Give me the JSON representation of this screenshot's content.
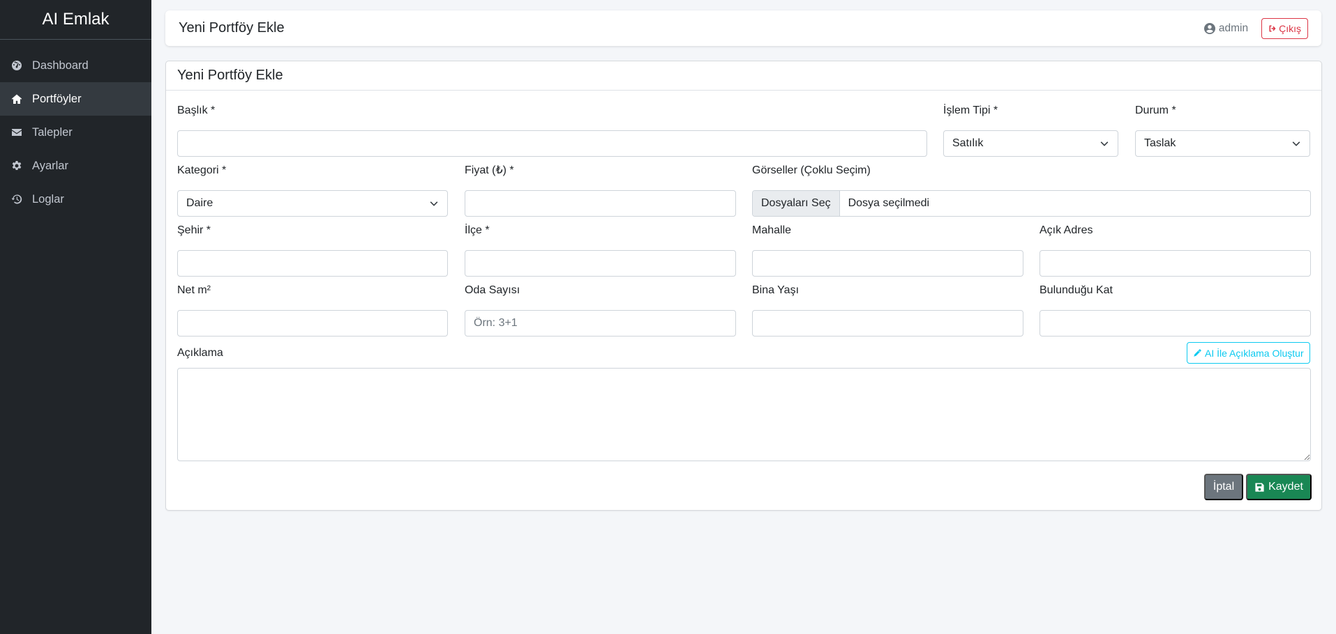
{
  "sidebar": {
    "brand": "AI Emlak",
    "items": [
      {
        "label": "Dashboard",
        "icon": "tachometer-icon",
        "active": false
      },
      {
        "label": "Portföyler",
        "icon": "home-icon",
        "active": true
      },
      {
        "label": "Talepler",
        "icon": "envelope-icon",
        "active": false
      },
      {
        "label": "Ayarlar",
        "icon": "gear-icon",
        "active": false
      },
      {
        "label": "Loglar",
        "icon": "history-icon",
        "active": false
      }
    ]
  },
  "topbar": {
    "title": "Yeni Portföy Ekle",
    "user": "admin",
    "logout_label": "Çıkış"
  },
  "form": {
    "card_title": "Yeni Portföy Ekle",
    "baslik": {
      "label": "Başlık *",
      "value": ""
    },
    "islem_tipi": {
      "label": "İşlem Tipi *",
      "value": "Satılık"
    },
    "durum": {
      "label": "Durum *",
      "value": "Taslak"
    },
    "kategori": {
      "label": "Kategori *",
      "value": "Daire"
    },
    "fiyat": {
      "label": "Fiyat (₺) *",
      "value": ""
    },
    "gorseller": {
      "label": "Görseller (Çoklu Seçim)",
      "button": "Dosyaları Seç",
      "status": "Dosya seçilmedi"
    },
    "sehir": {
      "label": "Şehir *",
      "value": ""
    },
    "ilce": {
      "label": "İlçe *",
      "value": ""
    },
    "mahalle": {
      "label": "Mahalle",
      "value": ""
    },
    "acik_adres": {
      "label": "Açık Adres",
      "value": ""
    },
    "net_m2": {
      "label": "Net m²",
      "value": ""
    },
    "oda_sayisi": {
      "label": "Oda Sayısı",
      "placeholder": "Örn: 3+1"
    },
    "bina_yasi": {
      "label": "Bina Yaşı",
      "value": ""
    },
    "bulundugu_kat": {
      "label": "Bulunduğu Kat",
      "value": ""
    },
    "aciklama": {
      "label": "Açıklama",
      "value": ""
    },
    "ai_button": "AI İle Açıklama Oluştur",
    "cancel_button": "İptal",
    "save_button": "Kaydet"
  },
  "colors": {
    "sidebar_bg": "#212529",
    "save": "#198754",
    "cancel": "#6c757d",
    "logout": "#dc3545",
    "ai": "#0dcaf0"
  }
}
